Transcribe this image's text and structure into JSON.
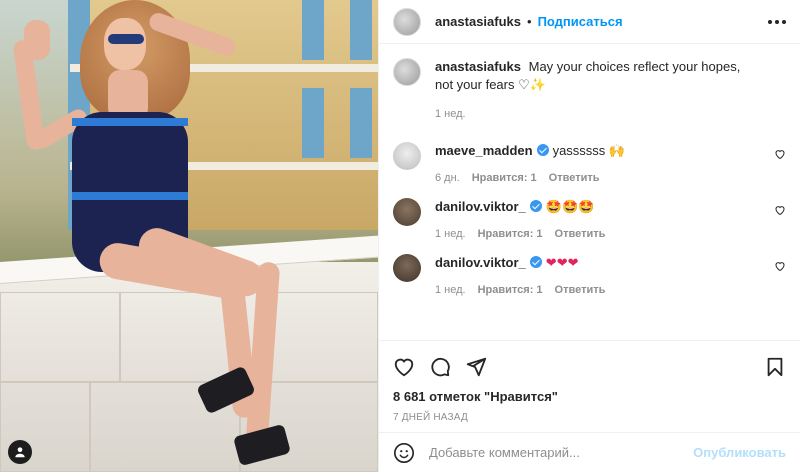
{
  "post": {
    "image_alt": "",
    "author": "anastasiafuks",
    "separator": "•",
    "follow_label": "Подписаться",
    "caption": "May your choices reflect your hopes, not your fears",
    "caption_emoji": "♡✨",
    "caption_time": "1 нед."
  },
  "comments": [
    {
      "user": "maeve_madden",
      "verified": true,
      "text": "yassssss 🙌",
      "time": "6 дн.",
      "likes": "Нравится: 1",
      "reply": "Ответить",
      "avatar_color": "#cfcfcf"
    },
    {
      "user": "danilov.viktor_",
      "verified": true,
      "text": "🤩🤩🤩",
      "time": "1 нед.",
      "likes": "Нравится: 1",
      "reply": "Ответить",
      "avatar_color": "#6b5a4b"
    },
    {
      "user": "danilov.viktor_",
      "verified": true,
      "text": "❤❤❤",
      "time": "1 нед.",
      "likes": "Нравится: 1",
      "reply": "Ответить",
      "avatar_color": "#5e4e40"
    }
  ],
  "actions": {
    "like_icon": "heart-icon",
    "comment_icon": "comment-icon",
    "share_icon": "share-icon",
    "save_icon": "bookmark-icon"
  },
  "stats": {
    "likes": "8 681 отметок \"Нравится\"",
    "date": "7 ДНЕЙ НАЗАД"
  },
  "composer": {
    "placeholder": "Добавьте комментарий...",
    "post_label": "Опубликовать"
  },
  "colors": {
    "accent": "#0095f6",
    "post_disabled": "#b2dffc",
    "verified": "#3897f0"
  }
}
